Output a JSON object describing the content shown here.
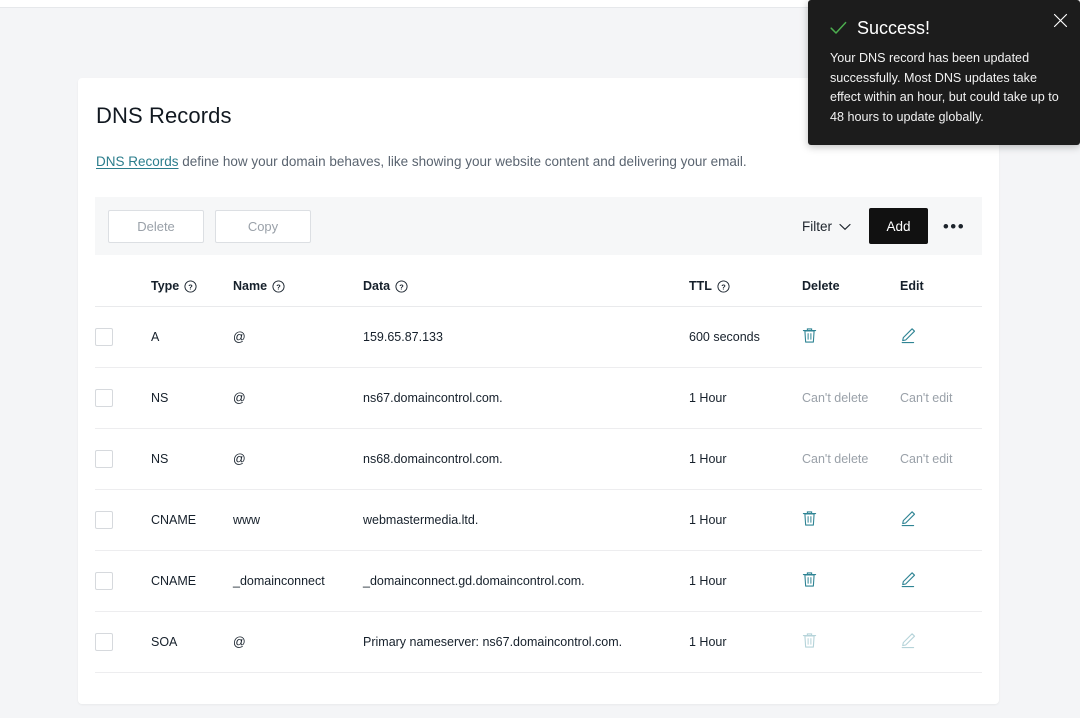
{
  "colors": {
    "accent_teal": "#2b7d8c",
    "icon_teal": "#2f8494",
    "toast_bg": "#1c1c1c",
    "success_green": "#4cae4f",
    "add_button_bg": "#111111",
    "page_bg": "#f4f5f7"
  },
  "page": {
    "title": "DNS Records",
    "subtitle_link": "DNS Records",
    "subtitle_rest": " define how your domain behaves, like showing your website content and delivering your email."
  },
  "toolbar": {
    "delete_label": "Delete",
    "copy_label": "Copy",
    "filter_label": "Filter",
    "filter_icon": "chevron-down-icon",
    "add_label": "Add",
    "more_label": "•••"
  },
  "table": {
    "columns": [
      {
        "key": "checkbox",
        "label": "",
        "help": false
      },
      {
        "key": "type",
        "label": "Type",
        "help": true
      },
      {
        "key": "name",
        "label": "Name",
        "help": true
      },
      {
        "key": "data",
        "label": "Data",
        "help": true
      },
      {
        "key": "ttl",
        "label": "TTL",
        "help": true
      },
      {
        "key": "delete",
        "label": "Delete",
        "help": false
      },
      {
        "key": "edit",
        "label": "Edit",
        "help": false
      }
    ],
    "cant_delete_label": "Can't delete",
    "cant_edit_label": "Can't edit",
    "rows": [
      {
        "type": "A",
        "name": "@",
        "data": "159.65.87.133",
        "ttl": "600 seconds",
        "delete_kind": "icon",
        "edit_kind": "icon",
        "selected": false
      },
      {
        "type": "NS",
        "name": "@",
        "data": "ns67.domaincontrol.com.",
        "ttl": "1 Hour",
        "delete_kind": "text",
        "edit_kind": "text",
        "selected": false
      },
      {
        "type": "NS",
        "name": "@",
        "data": "ns68.domaincontrol.com.",
        "ttl": "1 Hour",
        "delete_kind": "text",
        "edit_kind": "text",
        "selected": false
      },
      {
        "type": "CNAME",
        "name": "www",
        "data": "webmastermedia.ltd.",
        "ttl": "1 Hour",
        "delete_kind": "icon",
        "edit_kind": "icon",
        "selected": false
      },
      {
        "type": "CNAME",
        "name": "_domainconnect",
        "data": "_domainconnect.gd.domaincontrol.com.",
        "ttl": "1 Hour",
        "delete_kind": "icon",
        "edit_kind": "icon",
        "selected": false
      },
      {
        "type": "SOA",
        "name": "@",
        "data": "Primary nameserver: ns67.domaincontrol.com.",
        "ttl": "1 Hour",
        "delete_kind": "icon-disabled",
        "edit_kind": "icon-disabled",
        "selected": false
      }
    ]
  },
  "toast": {
    "icon": "check-icon",
    "title": "Success!",
    "message": "Your DNS record has been updated successfully. Most DNS updates take effect within an hour, but could take up to 48 hours to update globally.",
    "close_icon": "close-icon"
  }
}
